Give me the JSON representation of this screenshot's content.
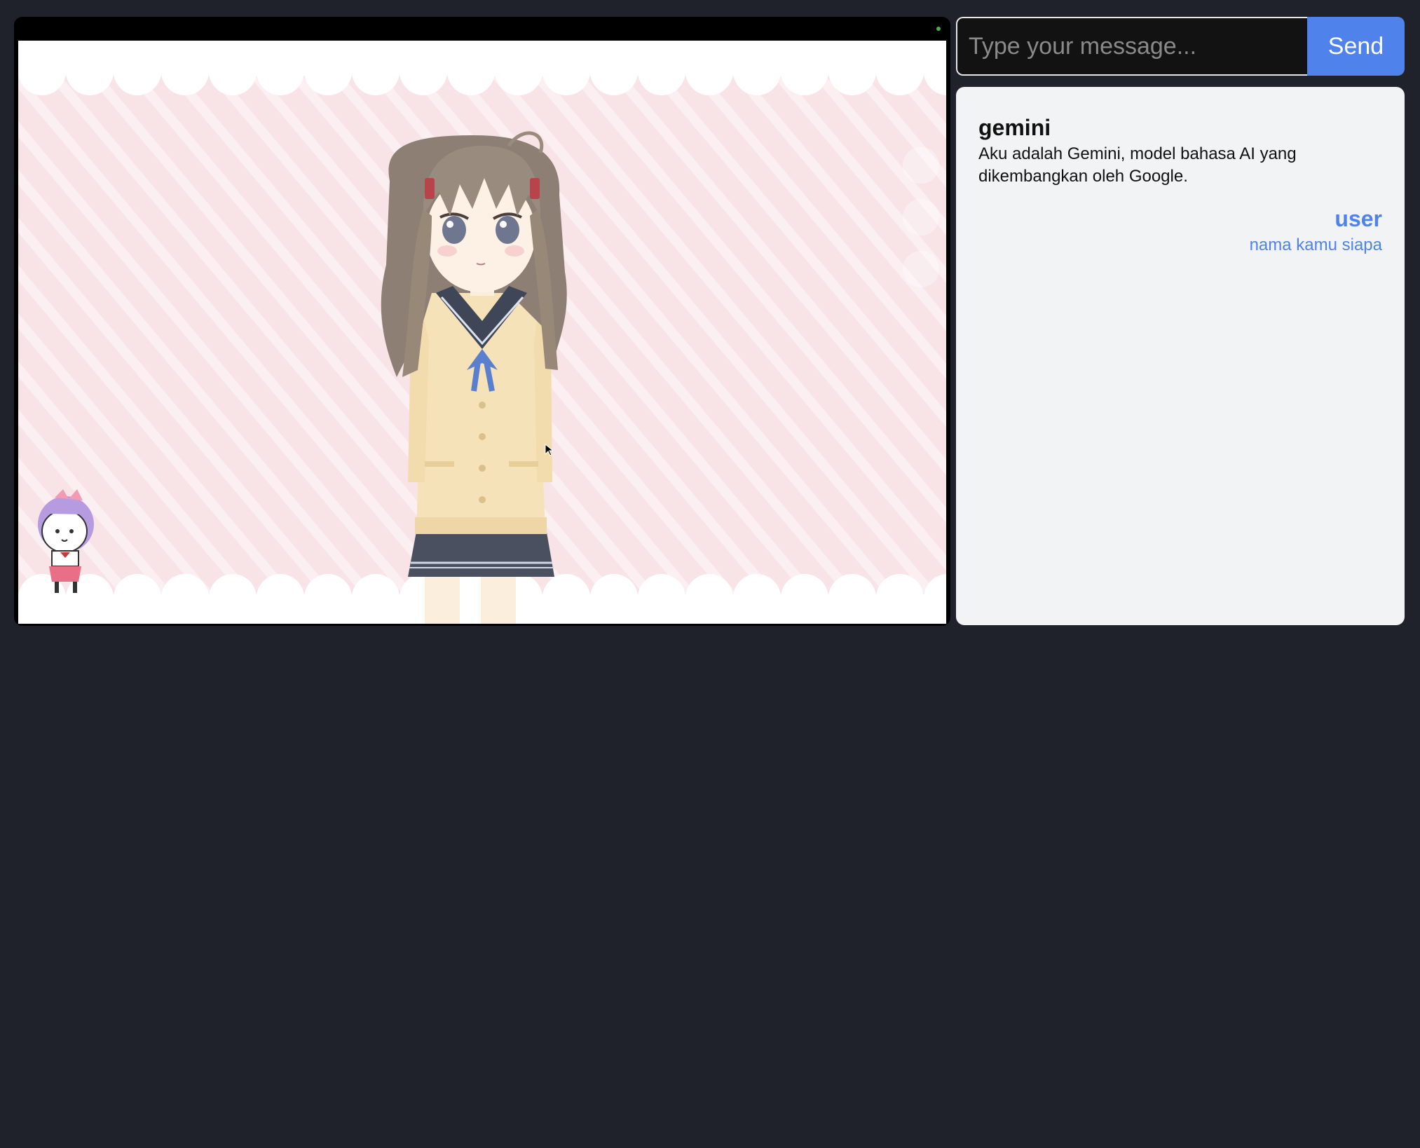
{
  "composer": {
    "placeholder": "Type your message...",
    "send_label": "Send"
  },
  "chat": {
    "messages": [
      {
        "sender": "gemini",
        "text": "Aku adalah Gemini, model bahasa AI yang dikembangkan oleh Google."
      },
      {
        "sender": "user",
        "text": "nama kamu siapa"
      }
    ]
  },
  "viewer": {
    "status": "online"
  },
  "colors": {
    "page_bg": "#1f222a",
    "accent": "#4f82ea",
    "chat_bg": "#f2f3f5",
    "stage_pink": "#f8e4e7"
  }
}
